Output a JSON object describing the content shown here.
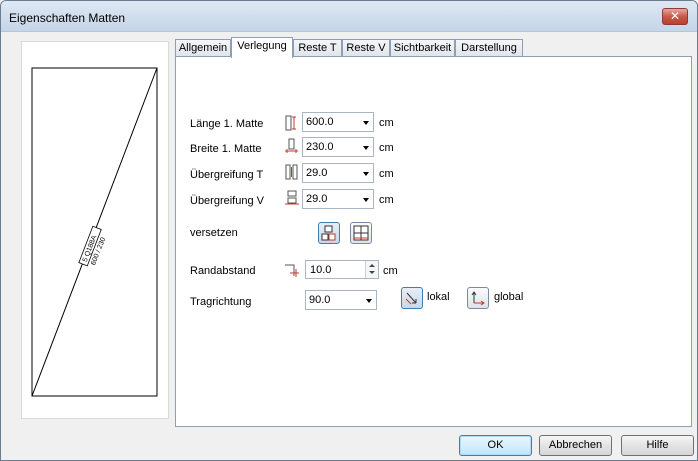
{
  "window": {
    "title": "Eigenschaften Matten",
    "close_glyph": "✕"
  },
  "preview": {
    "mat_label_line1": "5 Q188A",
    "mat_label_line2": "600 / 230"
  },
  "tabs": [
    {
      "label": "Allgemein",
      "active": false
    },
    {
      "label": "Verlegung",
      "active": true
    },
    {
      "label": "Reste T",
      "active": false
    },
    {
      "label": "Reste V",
      "active": false
    },
    {
      "label": "Sichtbarkeit",
      "active": false
    },
    {
      "label": "Darstellung",
      "active": false
    }
  ],
  "form": {
    "laenge": {
      "label": "Länge 1. Matte",
      "value": "600.0",
      "unit": "cm",
      "icon": "mat-length-icon"
    },
    "breite": {
      "label": "Breite 1. Matte",
      "value": "230.0",
      "unit": "cm",
      "icon": "mat-width-icon"
    },
    "uebergreifung_t": {
      "label": "Übergreifung T",
      "value": "29.0",
      "unit": "cm",
      "icon": "overlap-t-icon"
    },
    "uebergreifung_v": {
      "label": "Übergreifung V",
      "value": "29.0",
      "unit": "cm",
      "icon": "overlap-v-icon"
    },
    "versetzen": {
      "label": "versetzen"
    },
    "randabstand": {
      "label": "Randabstand",
      "value": "10.0",
      "unit": "cm",
      "icon": "edge-distance-icon"
    },
    "tragrichtung": {
      "label": "Tragrichtung",
      "value": "90.0",
      "lokal_label": "lokal",
      "global_label": "global"
    }
  },
  "buttons": {
    "ok": "OK",
    "abbrechen": "Abbrechen",
    "hilfe": "Hilfe"
  },
  "colors": {
    "accent": "#3c7fb1",
    "icon_red": "#c0392b",
    "tab_border": "#8f9fb3"
  }
}
